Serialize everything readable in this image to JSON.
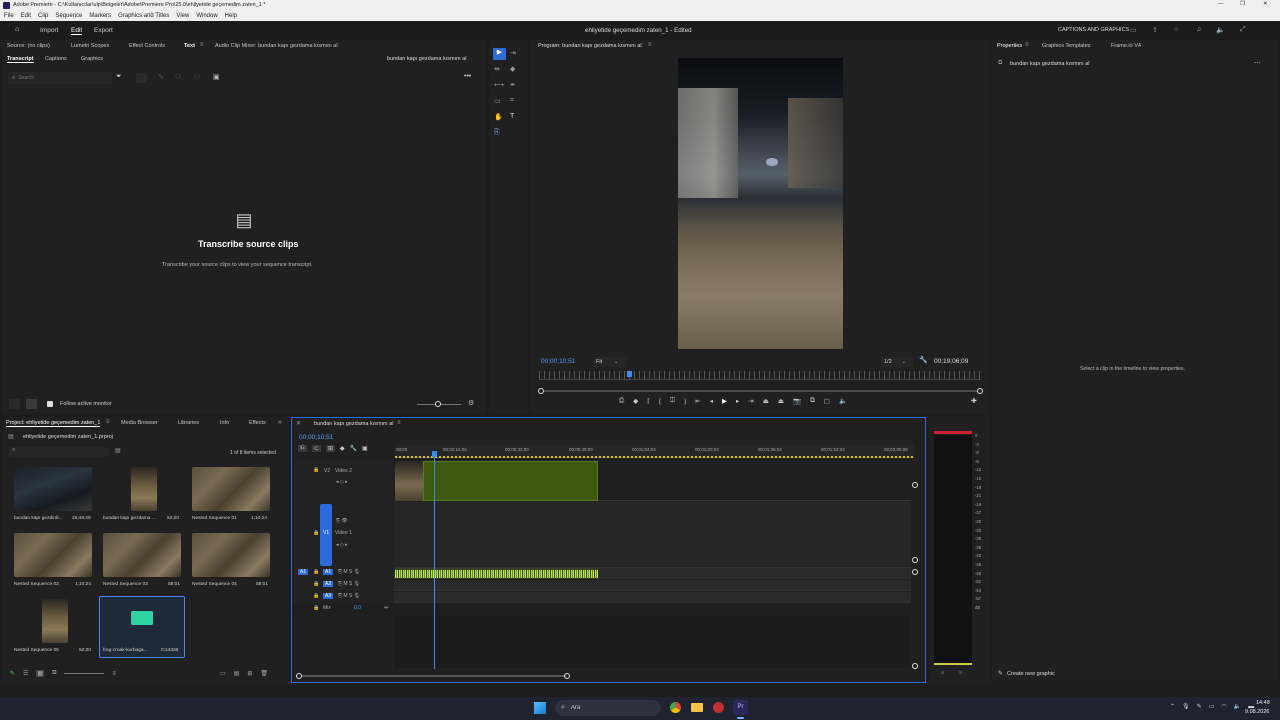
{
  "window": {
    "title": "Adobe Premiere - C:\\Kullanıcılar\\ulp\\Belgeler\\Adobe\\Premiere Pro\\25.0\\ehliyetide geçemedim zaten_1 *"
  },
  "menu": [
    "File",
    "Edit",
    "Clip",
    "Sequence",
    "Markers",
    "Graphics and Titles",
    "View",
    "Window",
    "Help"
  ],
  "header": {
    "tabs": [
      "Import",
      "Edit",
      "Export"
    ],
    "active_tab": "Edit",
    "project_title": "ehliyetide geçemedim zaten_1 - Edited",
    "captions_label": "CAPTIONS AND GRAPHICS"
  },
  "source_panel": {
    "tabs": [
      "Source: (no clips)",
      "Lumetri Scopes",
      "Effect Controls",
      "Text",
      "Audio Clip Mixer: bundan kapı gezdama kısmını al"
    ],
    "active_tab": "Text",
    "subtabs": [
      "Transcript",
      "Captions",
      "Graphics"
    ],
    "active_subtab": "Transcript",
    "sequence_name": "bundan kapı gezdama kısmını al",
    "search_placeholder": "Search",
    "empty_title": "Transcribe source clips",
    "empty_sub": "Transcribe your source clips to view your sequence transcript.",
    "follow_label": "Follow active monitor"
  },
  "program": {
    "tab": "Program: bundan kapı gezdama kısmını al",
    "timecode": "00;00;10;51",
    "fit": "Fit",
    "quality": "1/2",
    "duration": "00;19;06;09"
  },
  "properties": {
    "tabs": [
      "Properties",
      "Graphics Templates",
      "Frame.io V4"
    ],
    "active_tab": "Properties",
    "item": "bundan kapı gezdama kısmını al",
    "hint": "Select a clip in the timeline to view properties."
  },
  "project": {
    "tabs": [
      "Project: ehliyetide geçemedim zaten_1",
      "Media Browser",
      "Libraries",
      "Info",
      "Effects"
    ],
    "file": "ehliyetide geçemedim zaten_1.prproj",
    "selection": "1 of 8 items selected",
    "items": [
      {
        "name": "bundan kapı gezdirdi...",
        "dur": "25;49;29"
      },
      {
        "name": "bundan kapı gezdama ...",
        "dur": "52;20"
      },
      {
        "name": "Nested Sequence 01",
        "dur": "1;10;24"
      },
      {
        "name": "Nested Sequence 02",
        "dur": "1;10;24"
      },
      {
        "name": "Nested Sequence 03",
        "dur": "58;01"
      },
      {
        "name": "Nested Sequence 04",
        "dur": "58;01"
      },
      {
        "name": "Nested Sequence 05",
        "dur": "52;20"
      },
      {
        "name": "frog-croak-kurbaga...",
        "dur": "0;14336"
      }
    ]
  },
  "timeline": {
    "tab": "bundan kapı gezdama kısmını al",
    "timecode": "00;00;10;51",
    "ruler": [
      "00;00",
      "00;00;16;00",
      "00;00;32;00",
      "00;00;48;00",
      "00;01;04;04",
      "00;01;20;04",
      "00;01;36;04",
      "00;01;52;04",
      "00;02;08;08"
    ],
    "tracks": {
      "v2": "Video 2",
      "v1": "Video 1",
      "v2_id": "V2",
      "v1_id": "V1",
      "a1": "A1",
      "a2": "A2",
      "a3": "A3",
      "mix": "Mix",
      "mix_val": "0,0"
    }
  },
  "meter": {
    "labels": [
      "0",
      "-3",
      "-6",
      "-9",
      "-12",
      "-15",
      "-18",
      "-21",
      "-24",
      "-27",
      "-30",
      "-33",
      "-36",
      "-39",
      "-42",
      "-45",
      "-48",
      "-51",
      "-54",
      "-57",
      "dB"
    ],
    "bottom": [
      "S",
      "S"
    ]
  },
  "create_graphic": "Create new graphic",
  "taskbar": {
    "search": "Ara",
    "time": "14:48",
    "date": "9.08.2026"
  }
}
